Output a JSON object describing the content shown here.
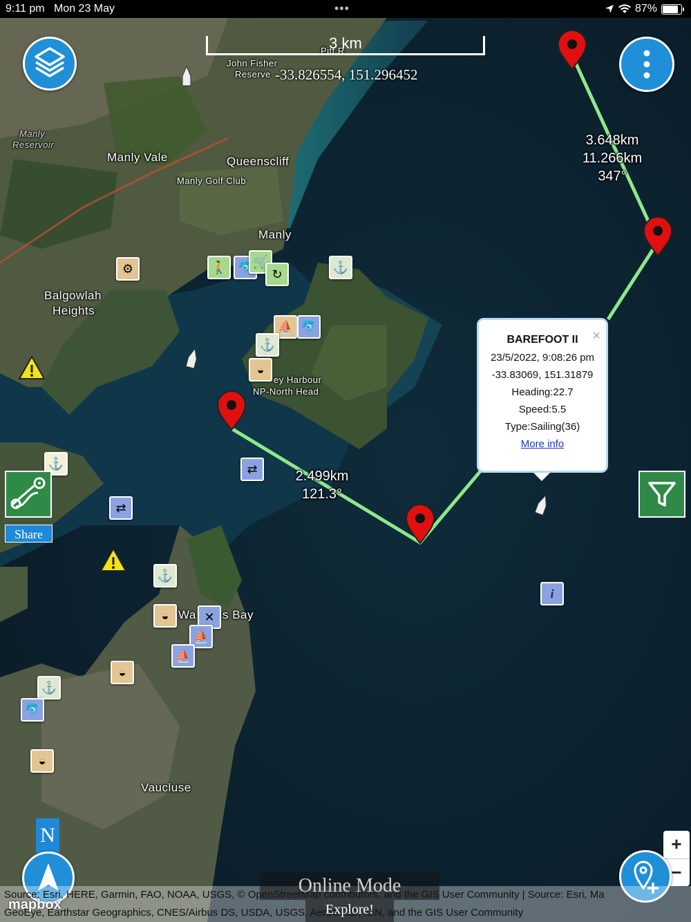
{
  "status_bar": {
    "time": "9:11 pm",
    "date": "Mon 23 May",
    "dots": "•••",
    "battery": "87%",
    "icons": [
      "location-arrow-icon",
      "wifi-icon",
      "battery-icon"
    ]
  },
  "map": {
    "scale_label": "3 km",
    "cursor_coords": "-33.826554, 151.296452",
    "places": {
      "manly_vale": "Manly Vale",
      "queenscliff": "Queenscliff",
      "manly_golf_club": "Manly Golf Club",
      "manly": "Manly",
      "balgowlah_heights_1": "Balgowlah",
      "balgowlah_heights_2": "Heights",
      "manly_reservoir_1": "Manly",
      "manly_reservoir_2": "Reservoir",
      "john_fisher_1": "John Fisher",
      "john_fisher_2": "Reserve",
      "north_head_1": "ey Harbour",
      "north_head_2": "NP-North Head",
      "watsons_bay_1": "Wa",
      "watsons_bay_2": "s Bay",
      "vaucluse": "Vaucluse",
      "pitt_road": "Pitt R"
    },
    "segments": [
      {
        "line1": "3.648km",
        "line2": "11.266km",
        "line3": "347°"
      },
      {
        "line1": "2.499km",
        "line2": "121.3°"
      }
    ]
  },
  "vessel_popup": {
    "name": "BAREFOOT II",
    "timestamp": "23/5/2022, 9:08:26 pm",
    "position": "-33.83069, 151.31879",
    "heading": "Heading:22.7",
    "speed": "Speed:5.5",
    "type": "Type:Sailing(36)",
    "more_info": "More info",
    "close": "×"
  },
  "controls": {
    "share_label": "Share",
    "north_label": "N",
    "zoom_in": "+",
    "zoom_out": "−"
  },
  "attribution": {
    "line1": "Source: Esri, HERE, Garmin, FAO, NOAA, USGS, © OpenStreetMap contributors, and the GIS User Community | Source: Esri, Ma",
    "line2": "GeoEye, Earthstar Geographics, CNES/Airbus DS, USDA, USGS, AeroGRID, IGN, and the GIS User Community",
    "mapbox": "mapbox"
  },
  "mode": {
    "online_mode": "Online Mode",
    "explore": "Explore!"
  },
  "colors": {
    "accent": "#1f8fd8",
    "route": "#8ee88a",
    "filter_green": "#2f8a47",
    "pin_red": "#e01010"
  }
}
